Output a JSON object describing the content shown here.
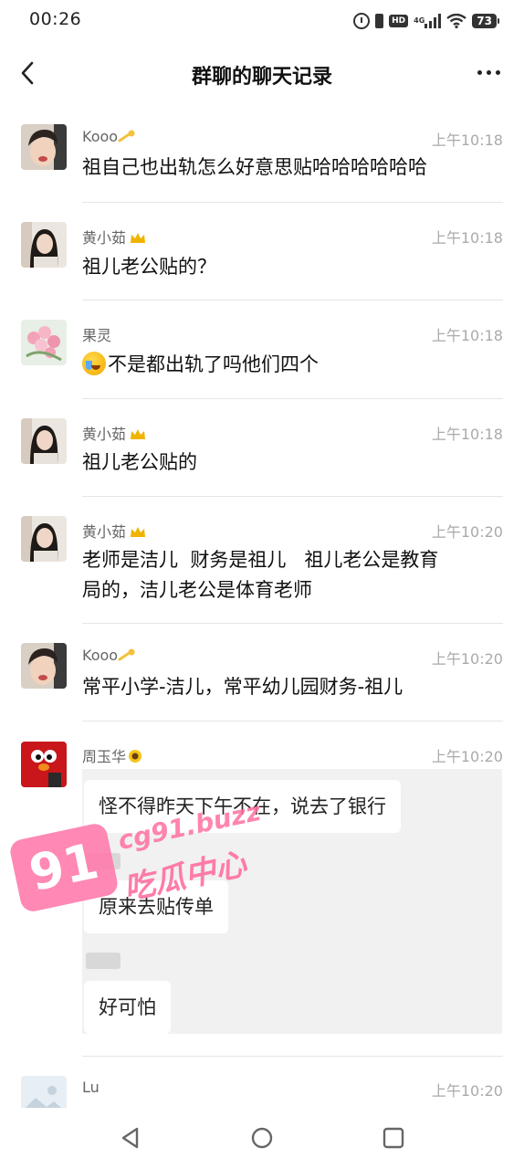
{
  "status_bar": {
    "time": "00:26",
    "hd_label": "HD",
    "network_label": "4G",
    "battery": "73"
  },
  "nav": {
    "title": "群聊的聊天记录"
  },
  "messages": [
    {
      "sender": "Kooo",
      "time": "上午10:18",
      "text": "祖自己也出轨怎么好意思贴哈哈哈哈哈哈",
      "badge": "comet-emoji"
    },
    {
      "sender": "黄小茹",
      "time": "上午10:18",
      "text": "祖儿老公贴的？",
      "badge": "crown-emoji"
    },
    {
      "sender": "果灵",
      "time": "上午10:18",
      "text": "不是都出轨了吗他们四个",
      "leading_emoji": "crying-face-emoji"
    },
    {
      "sender": "黄小茹",
      "time": "上午10:18",
      "text": "祖儿老公贴的",
      "badge": "crown-emoji"
    },
    {
      "sender": "黄小茹",
      "time": "上午10:20",
      "text_line1": "老师是洁儿  财务是祖儿   祖儿老公是教育",
      "text_line2": "局的，洁儿老公是体育老师",
      "badge": "crown-emoji"
    },
    {
      "sender": "Kooo",
      "time": "上午10:20",
      "text": "常平小学-洁儿，常平幼儿园财务-祖儿",
      "badge": "comet-emoji"
    },
    {
      "sender": "周玉华",
      "time": "上午10:20",
      "badge": "sunflower-emoji",
      "image_bubbles": [
        "怪不得昨天下午不在，说去了银行",
        "原来去贴传单",
        "好可怕"
      ]
    },
    {
      "sender": "Lu",
      "time": "上午10:20"
    }
  ],
  "watermark": {
    "badge": "91",
    "url": "cg91.buzz",
    "text": "吃瓜中心"
  },
  "colors": {
    "background": "#ffffff",
    "divider": "#e5e5e5",
    "timestamp": "#aaaaaa",
    "watermark_pink": "#ff78aa"
  }
}
